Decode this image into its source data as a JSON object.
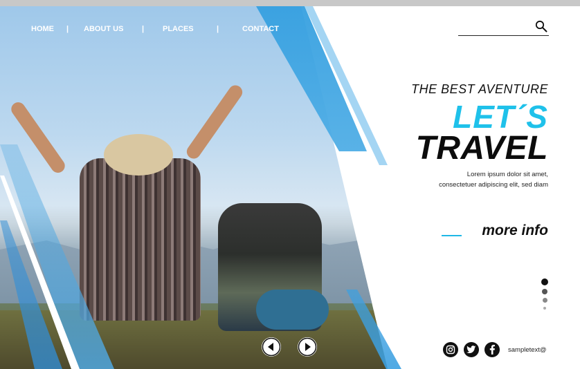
{
  "nav": {
    "items": [
      {
        "label": "HOME"
      },
      {
        "label": "ABOUT US"
      },
      {
        "label": "PLACES"
      },
      {
        "label": "CONTACT"
      }
    ],
    "separator": "|"
  },
  "hero": {
    "subheading": "THE BEST AVENTURE",
    "heading_line1": "LET´S",
    "heading_line2": "TRAVEL",
    "description_line1": "Lorem ipsum dolor sit amet,",
    "description_line2": "consectetuer adipiscing elit, sed diam",
    "more_info": "more info"
  },
  "pager": {
    "count": 4,
    "active_index": 0
  },
  "carousel": {
    "prev_icon": "chevron-left-icon",
    "next_icon": "chevron-right-icon"
  },
  "social": {
    "icons": [
      "instagram-icon",
      "twitter-icon",
      "facebook-icon"
    ],
    "email": "sampletext@"
  },
  "colors": {
    "accent": "#1fc1ea",
    "stripe_blue": "#36a0e0",
    "text_dark": "#0c0c0c"
  }
}
